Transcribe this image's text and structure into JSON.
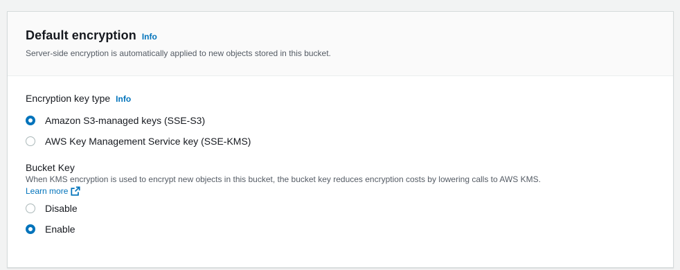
{
  "header": {
    "title": "Default encryption",
    "info_label": "Info",
    "description": "Server-side encryption is automatically applied to new objects stored in this bucket."
  },
  "encryption_key_type": {
    "label": "Encryption key type",
    "info_label": "Info",
    "selected": "sse-s3",
    "options": [
      {
        "id": "sse-s3",
        "label": "Amazon S3-managed keys (SSE-S3)",
        "checked": true
      },
      {
        "id": "sse-kms",
        "label": "AWS Key Management Service key (SSE-KMS)",
        "checked": false
      }
    ]
  },
  "bucket_key": {
    "label": "Bucket Key",
    "description": "When KMS encryption is used to encrypt new objects in this bucket, the bucket key reduces encryption costs by lowering calls to AWS KMS.",
    "learn_more": "Learn more",
    "learn_more_icon": "external-link-icon",
    "selected": "enable",
    "options": [
      {
        "id": "disable",
        "label": "Disable",
        "checked": false
      },
      {
        "id": "enable",
        "label": "Enable",
        "checked": true
      }
    ]
  },
  "colors": {
    "accent": "#0073bb",
    "text": "#16191f",
    "muted_text": "#545b64",
    "header_bg": "#fafafa",
    "border": "#d5dbdb"
  }
}
